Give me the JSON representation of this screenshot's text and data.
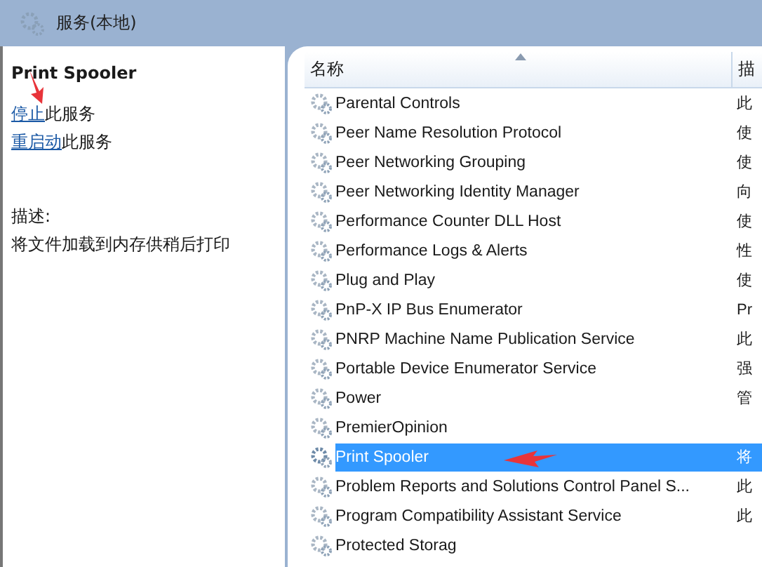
{
  "header": {
    "title": "服务(本地)"
  },
  "detail": {
    "service_name": "Print Spooler",
    "actions": [
      {
        "link": "停止",
        "text": "此服务",
        "arrow": true
      },
      {
        "link": "重启动",
        "text": "此服务",
        "arrow": false
      }
    ],
    "description_label": "描述:",
    "description": "将文件加载到内存供稍后打印"
  },
  "table": {
    "columns": [
      "名称",
      "描"
    ],
    "rows": [
      {
        "name": "Parental Controls",
        "column_2": "此",
        "selected": false,
        "arrow": false
      },
      {
        "name": "Peer Name Resolution Protocol",
        "column_2": "使",
        "selected": false,
        "arrow": false
      },
      {
        "name": "Peer Networking Grouping",
        "column_2": "使",
        "selected": false,
        "arrow": false
      },
      {
        "name": "Peer Networking Identity Manager",
        "column_2": "向",
        "selected": false,
        "arrow": false
      },
      {
        "name": "Performance Counter DLL Host",
        "column_2": "使",
        "selected": false,
        "arrow": false
      },
      {
        "name": "Performance Logs & Alerts",
        "column_2": "性",
        "selected": false,
        "arrow": false
      },
      {
        "name": "Plug and Play",
        "column_2": "使",
        "selected": false,
        "arrow": false
      },
      {
        "name": "PnP-X IP Bus Enumerator",
        "column_2": "Pr",
        "selected": false,
        "arrow": false
      },
      {
        "name": "PNRP Machine Name Publication Service",
        "column_2": "此",
        "selected": false,
        "arrow": false
      },
      {
        "name": "Portable Device Enumerator Service",
        "column_2": "强",
        "selected": false,
        "arrow": false
      },
      {
        "name": "Power",
        "column_2": "管",
        "selected": false,
        "arrow": false
      },
      {
        "name": "PremierOpinion",
        "selected": false,
        "arrow": false
      },
      {
        "name": "Print Spooler",
        "column_2": "将",
        "selected": true,
        "arrow": true
      },
      {
        "name": "Problem Reports and Solutions Control Panel S...",
        "column_2": "此",
        "selected": false,
        "arrow": false
      },
      {
        "name": "Program Compatibility Assistant Service",
        "column_2": "此",
        "selected": false,
        "arrow": false
      },
      {
        "name": "Protected Storag",
        "selected": false,
        "arrow": false
      }
    ]
  }
}
